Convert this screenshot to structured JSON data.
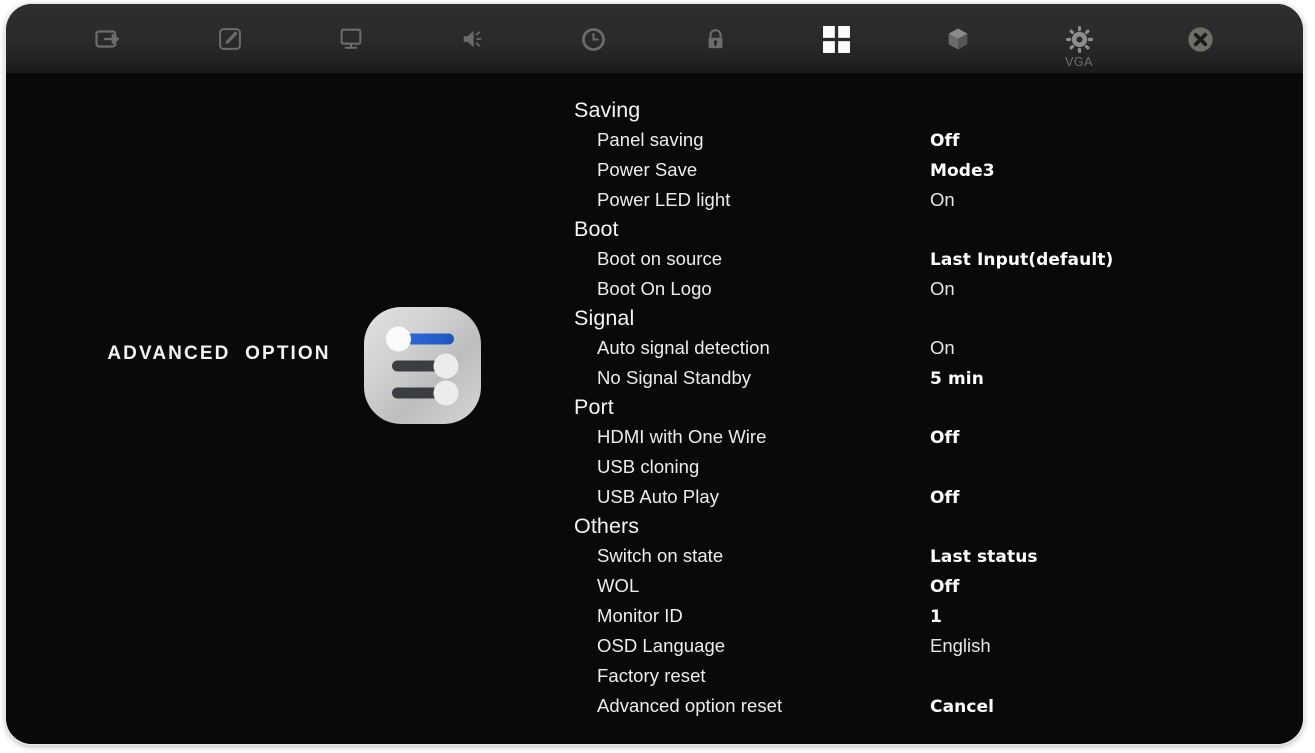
{
  "window": {
    "border_color": "#e9e9ec",
    "background": "#0a0a0a",
    "topbar_background": "#2a2a2a"
  },
  "topbar": {
    "tabs": [
      {
        "icon": "input-source-icon",
        "label": "",
        "active": false
      },
      {
        "icon": "picture-edit-icon",
        "label": "",
        "active": false
      },
      {
        "icon": "screen-display-icon",
        "label": "",
        "active": false
      },
      {
        "icon": "speaker-sound-icon",
        "label": "",
        "active": false
      },
      {
        "icon": "clock-time-icon",
        "label": "",
        "active": false
      },
      {
        "icon": "lock-security-icon",
        "label": "",
        "active": false
      },
      {
        "icon": "grid-advanced-option-icon",
        "label": "",
        "active": true
      },
      {
        "icon": "cube-3d-icon",
        "label": "",
        "active": false
      },
      {
        "icon": "gear-settings-icon",
        "label": "VGA",
        "active": false
      },
      {
        "icon": "close-circle-icon",
        "label": "",
        "active": false
      }
    ]
  },
  "category": {
    "title": "ADVANCED  OPTION",
    "icon": "sliders-settings-icon",
    "icon_accent_color": "#2563d6",
    "icon_body_color": "#c8c8c8"
  },
  "settings": {
    "groups": [
      {
        "title": "Saving",
        "items": [
          {
            "label": "Panel saving",
            "value": "Off",
            "bold": true
          },
          {
            "label": "Power Save",
            "value": "Mode3",
            "bold": true
          },
          {
            "label": "Power LED light",
            "value": "On",
            "bold": false
          }
        ]
      },
      {
        "title": "Boot",
        "items": [
          {
            "label": "Boot on source",
            "value": "Last Input(default)",
            "bold": true
          },
          {
            "label": "Boot On Logo",
            "value": "On",
            "bold": false
          }
        ]
      },
      {
        "title": "Signal",
        "items": [
          {
            "label": "Auto signal detection",
            "value": "On",
            "bold": false
          },
          {
            "label": "No Signal Standby",
            "value": "5 min",
            "bold": true
          }
        ]
      },
      {
        "title": "Port",
        "items": [
          {
            "label": "HDMI with One Wire",
            "value": "Off",
            "bold": true
          },
          {
            "label": "USB cloning",
            "value": "",
            "bold": false
          },
          {
            "label": "USB Auto Play",
            "value": "Off",
            "bold": true
          }
        ]
      },
      {
        "title": "Others",
        "items": [
          {
            "label": "Switch on state",
            "value": "Last status",
            "bold": true
          },
          {
            "label": "WOL",
            "value": "Off",
            "bold": true
          },
          {
            "label": "Monitor ID",
            "value": "1",
            "bold": true
          },
          {
            "label": "OSD Language",
            "value": "English",
            "bold": false
          },
          {
            "label": "Factory reset",
            "value": "",
            "bold": false
          },
          {
            "label": "Advanced option reset",
            "value": "Cancel",
            "bold": true
          }
        ]
      }
    ]
  }
}
